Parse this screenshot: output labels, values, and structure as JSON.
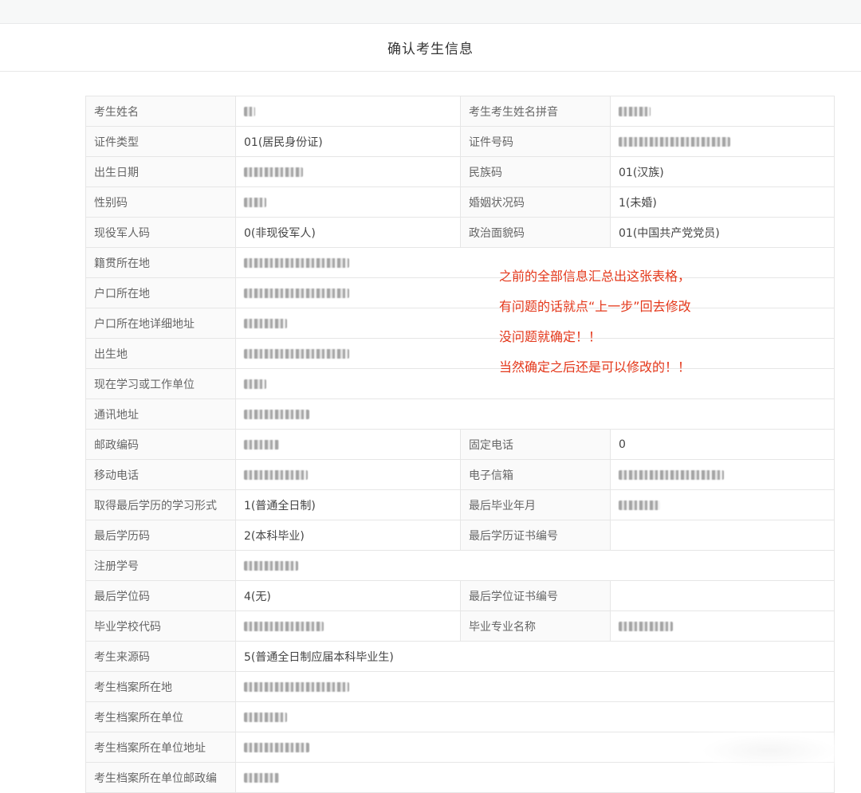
{
  "page": {
    "title": "确认考生信息"
  },
  "rows": [
    {
      "l1": "考生姓名",
      "v1": null,
      "b1": 14,
      "l2": "考生考生姓名拼音",
      "v2": null,
      "b2": 40
    },
    {
      "l1": "证件类型",
      "v1": "01(居民身份证)",
      "l2": "证件号码",
      "v2": null,
      "b2": 140
    },
    {
      "l1": "出生日期",
      "v1": null,
      "b1": 74,
      "l2": "民族码",
      "v2": "01(汉族)"
    },
    {
      "l1": "性别码",
      "v1": null,
      "b1": 28,
      "l2": "婚姻状况码",
      "v2": "1(未婚)"
    },
    {
      "l1": "现役军人码",
      "v1": "0(非现役军人)",
      "l2": "政治面貌码",
      "v2": "01(中国共产党党员)"
    },
    {
      "l1": "籍贯所在地",
      "v1": null,
      "b1": 132
    },
    {
      "l1": "户口所在地",
      "v1": null,
      "b1": 132
    },
    {
      "l1": "户口所在地详细地址",
      "v1": null,
      "b1": 54
    },
    {
      "l1": "出生地",
      "v1": null,
      "b1": 132
    },
    {
      "l1": "现在学习或工作单位",
      "v1": null,
      "b1": 28
    },
    {
      "l1": "通讯地址",
      "v1": null,
      "b1": 82
    },
    {
      "l1": "邮政编码",
      "v1": null,
      "b1": 44,
      "l2": "固定电话",
      "v2": "0"
    },
    {
      "l1": "移动电话",
      "v1": null,
      "b1": 80,
      "l2": "电子信箱",
      "v2": null,
      "b2": 132
    },
    {
      "l1": "取得最后学历的学习形式",
      "v1": "1(普通全日制)",
      "l2": "最后毕业年月",
      "v2": null,
      "b2": 52
    },
    {
      "l1": "最后学历码",
      "v1": "2(本科毕业)",
      "l2": "最后学历证书编号",
      "v2": ""
    },
    {
      "l1": "注册学号",
      "v1": null,
      "b1": 68
    },
    {
      "l1": "最后学位码",
      "v1": "4(无)",
      "l2": "最后学位证书编号",
      "v2": ""
    },
    {
      "l1": "毕业学校代码",
      "v1": null,
      "b1": 100,
      "l2": "毕业专业名称",
      "v2": null,
      "b2": 68
    },
    {
      "l1": "考生来源码",
      "v1": "5(普通全日制应届本科毕业生)"
    },
    {
      "l1": "考生档案所在地",
      "v1": null,
      "b1": 132
    },
    {
      "l1": "考生档案所在单位",
      "v1": null,
      "b1": 54
    },
    {
      "l1": "考生档案所在单位地址",
      "v1": null,
      "b1": 82
    },
    {
      "l1": "考生档案所在单位邮政编",
      "v1": null,
      "b1": 44
    }
  ],
  "annotation": {
    "lines": [
      "之前的全部信息汇总出这张表格，",
      "有问题的话就点“上一步”回去修改",
      "没问题就确定！！",
      "当然确定之后还是可以修改的！！"
    ],
    "color": "#e4381b"
  },
  "colors": {
    "label_bg": "#fafafa",
    "border": "#e6e6e6",
    "header_strip": "#f7f8f8"
  }
}
